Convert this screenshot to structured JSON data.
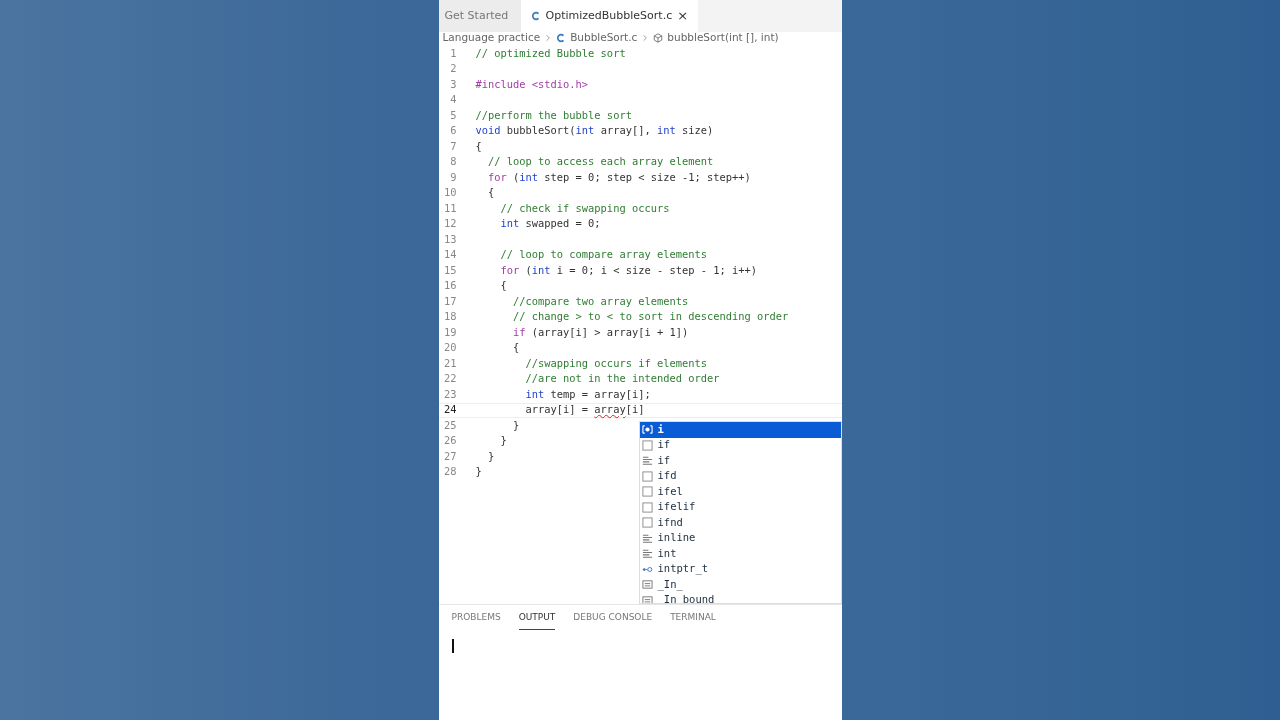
{
  "tabs": [
    {
      "label": "Get Started",
      "icon": false,
      "closable": false,
      "selected": false
    },
    {
      "label": "OptimizedBubbleSort.c",
      "icon": true,
      "closable": true,
      "selected": true
    }
  ],
  "close_glyph": "×",
  "breadcrumb": [
    {
      "label": "Language practice",
      "kind": "folder"
    },
    {
      "label": "BubbleSort.c",
      "kind": "file"
    },
    {
      "label": "bubbleSort(int [], int)",
      "kind": "function"
    }
  ],
  "code_lines": [
    {
      "number": "1",
      "current": false,
      "segments": [
        {
          "t": "// optimized Bubble sort",
          "kind": "comment"
        }
      ]
    },
    {
      "number": "2",
      "current": false
    },
    {
      "number": "3",
      "current": false,
      "segments": [
        {
          "t": "#include <stdio.h>",
          "kind": "directive"
        }
      ]
    },
    {
      "number": "4",
      "current": false
    },
    {
      "number": "5",
      "current": false,
      "segments": [
        {
          "t": "//perform the bubble sort",
          "kind": "comment"
        }
      ]
    },
    {
      "number": "6",
      "current": false,
      "segments": [
        {
          "t": "void",
          "kind": "keyword"
        },
        {
          "t": " bubbleSort(",
          "kind": "plain"
        },
        {
          "t": "int",
          "kind": "keyword"
        },
        {
          "t": " array[], ",
          "kind": "plain"
        },
        {
          "t": "int",
          "kind": "keyword"
        },
        {
          "t": " size)",
          "kind": "plain"
        }
      ]
    },
    {
      "number": "7",
      "current": false,
      "segments": [
        {
          "t": "{",
          "kind": "plain"
        }
      ]
    },
    {
      "number": "8",
      "current": false,
      "segments": [
        {
          "t": "  // loop to access each array element",
          "kind": "comment"
        }
      ]
    },
    {
      "number": "9",
      "current": false,
      "segments": [
        {
          "t": "  for",
          "kind": "control"
        },
        {
          "t": " (",
          "kind": "plain"
        },
        {
          "t": "int",
          "kind": "keyword"
        },
        {
          "t": " step = 0; step < size -1; step++)",
          "kind": "plain"
        }
      ]
    },
    {
      "number": "10",
      "current": false,
      "segments": [
        {
          "t": "  {",
          "kind": "plain"
        }
      ]
    },
    {
      "number": "11",
      "current": false,
      "segments": [
        {
          "t": "    // check if swapping occurs",
          "kind": "comment"
        }
      ]
    },
    {
      "number": "12",
      "current": false,
      "segments": [
        {
          "t": "    int",
          "kind": "keyword"
        },
        {
          "t": " swapped = 0;",
          "kind": "plain"
        }
      ]
    },
    {
      "number": "13",
      "current": false
    },
    {
      "number": "14",
      "current": false,
      "segments": [
        {
          "t": "    // loop to compare array elements",
          "kind": "comment"
        }
      ]
    },
    {
      "number": "15",
      "current": false,
      "segments": [
        {
          "t": "    for",
          "kind": "control"
        },
        {
          "t": " (",
          "kind": "plain"
        },
        {
          "t": "int",
          "kind": "keyword"
        },
        {
          "t": " i = 0; i < size - step - 1; i++)",
          "kind": "plain"
        }
      ]
    },
    {
      "number": "16",
      "current": false,
      "segments": [
        {
          "t": "    {",
          "kind": "plain"
        }
      ]
    },
    {
      "number": "17",
      "current": false,
      "segments": [
        {
          "t": "      //compare two array elements",
          "kind": "comment"
        }
      ]
    },
    {
      "number": "18",
      "current": false,
      "segments": [
        {
          "t": "      // change > to < to sort in descending order",
          "kind": "comment"
        }
      ]
    },
    {
      "number": "19",
      "current": false,
      "segments": [
        {
          "t": "      if",
          "kind": "control"
        },
        {
          "t": " (array[i] > array[i + 1])",
          "kind": "plain"
        }
      ]
    },
    {
      "number": "20",
      "current": false,
      "segments": [
        {
          "t": "      {",
          "kind": "plain"
        }
      ]
    },
    {
      "number": "21",
      "current": false,
      "segments": [
        {
          "t": "        //swapping occurs if elements",
          "kind": "comment"
        }
      ]
    },
    {
      "number": "22",
      "current": false,
      "segments": [
        {
          "t": "        //are not in the intended order",
          "kind": "comment"
        }
      ]
    },
    {
      "number": "23",
      "current": false,
      "segments": [
        {
          "t": "        int",
          "kind": "keyword"
        },
        {
          "t": " temp = array[i];",
          "kind": "plain"
        }
      ]
    },
    {
      "number": "24",
      "current": true,
      "segments": [
        {
          "t": "        array[i] = ",
          "kind": "plain"
        },
        {
          "t": "array",
          "kind": "error"
        },
        {
          "t": "[i]",
          "kind": "plain"
        }
      ]
    },
    {
      "number": "25",
      "current": false,
      "segments": [
        {
          "t": "      }",
          "kind": "plain"
        }
      ]
    },
    {
      "number": "26",
      "current": false,
      "segments": [
        {
          "t": "    }",
          "kind": "plain"
        }
      ]
    },
    {
      "number": "27",
      "current": false,
      "segments": [
        {
          "t": "  }",
          "kind": "plain"
        }
      ]
    },
    {
      "number": "28",
      "current": false,
      "segments": [
        {
          "t": "}",
          "kind": "plain"
        }
      ]
    }
  ],
  "suggestions": [
    {
      "label": "i",
      "kind": "variable",
      "selected": true
    },
    {
      "label": "if",
      "kind": "snippet",
      "selected": false
    },
    {
      "label": "if",
      "kind": "keyword",
      "selected": false
    },
    {
      "label": "ifd",
      "kind": "snippet",
      "selected": false
    },
    {
      "label": "ifel",
      "kind": "snippet",
      "selected": false
    },
    {
      "label": "ifelif",
      "kind": "snippet",
      "selected": false
    },
    {
      "label": "ifnd",
      "kind": "snippet",
      "selected": false
    },
    {
      "label": "inline",
      "kind": "keyword",
      "selected": false
    },
    {
      "label": "int",
      "kind": "keyword",
      "selected": false
    },
    {
      "label": "intptr_t",
      "kind": "type",
      "selected": false
    },
    {
      "label": "_In_",
      "kind": "text",
      "selected": false
    },
    {
      "label": " In bound",
      "kind": "text",
      "selected": false
    }
  ],
  "panel_tabs": [
    {
      "label": "PROBLEMS",
      "selected": false
    },
    {
      "label": "OUTPUT",
      "selected": true
    },
    {
      "label": "DEBUG CONSOLE",
      "selected": false
    },
    {
      "label": "TERMINAL",
      "selected": false
    }
  ]
}
